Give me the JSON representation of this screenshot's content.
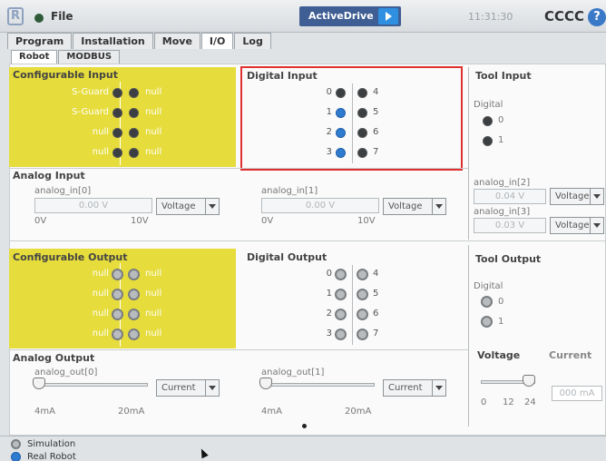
{
  "topbar": {
    "logo": "R",
    "file_label": "File",
    "active_drive_label": "ActiveDrive",
    "clock": "11:31:30",
    "robot_name": "CCCC",
    "help_label": "?"
  },
  "tabs": [
    "Program",
    "Installation",
    "Move",
    "I/O",
    "Log"
  ],
  "subtabs": [
    "Robot",
    "MODBUS"
  ],
  "configurable_input": {
    "title": "Configurable Input",
    "rows": [
      {
        "left": "S-Guard",
        "right": "null"
      },
      {
        "left": "S-Guard",
        "right": "null"
      },
      {
        "left": "null",
        "right": "null"
      },
      {
        "left": "null",
        "right": "null"
      }
    ]
  },
  "digital_input": {
    "title": "Digital Input",
    "rows": [
      {
        "left": "0",
        "right": "4"
      },
      {
        "left": "1",
        "right": "5"
      },
      {
        "left": "2",
        "right": "6"
      },
      {
        "left": "3",
        "right": "7"
      }
    ]
  },
  "tool_input": {
    "title": "Tool Input",
    "digital_label": "Digital",
    "items": [
      "0",
      "1"
    ],
    "analog2_label": "analog_in[2]",
    "analog2_value": "0.04 V",
    "analog2_mode": "Voltage",
    "analog3_label": "analog_in[3]",
    "analog3_value": "0.03 V",
    "analog3_mode": "Voltage"
  },
  "analog_input": {
    "title": "Analog Input",
    "in0_label": "analog_in[0]",
    "in0_value": "0.00 V",
    "in0_mode": "Voltage",
    "in0_min": "0V",
    "in0_max": "10V",
    "in1_label": "analog_in[1]",
    "in1_value": "0.00 V",
    "in1_mode": "Voltage",
    "in1_min": "0V",
    "in1_max": "10V"
  },
  "configurable_output": {
    "title": "Configurable Output",
    "rows": [
      {
        "left": "null",
        "right": "null"
      },
      {
        "left": "null",
        "right": "null"
      },
      {
        "left": "null",
        "right": "null"
      },
      {
        "left": "null",
        "right": "null"
      }
    ]
  },
  "digital_output": {
    "title": "Digital Output",
    "rows": [
      {
        "left": "0",
        "right": "4"
      },
      {
        "left": "1",
        "right": "5"
      },
      {
        "left": "2",
        "right": "6"
      },
      {
        "left": "3",
        "right": "7"
      }
    ]
  },
  "tool_output": {
    "title": "Tool Output",
    "digital_label": "Digital",
    "items": [
      "0",
      "1"
    ],
    "voltage_label": "Voltage",
    "current_label": "Current",
    "voltage_ticks": [
      "0",
      "12",
      "24"
    ],
    "current_value": "000 mA",
    "voltage_fraction": 1.0
  },
  "analog_output": {
    "title": "Analog Output",
    "out0_label": "analog_out[0]",
    "out0_mode": "Current",
    "out0_min": "4mA",
    "out0_max": "20mA",
    "out0_fraction": 0.0,
    "out1_label": "analog_out[1]",
    "out1_mode": "Current",
    "out1_min": "4mA",
    "out1_max": "20mA",
    "out1_fraction": 0.0
  },
  "footer": {
    "simulation_label": "Simulation",
    "real_robot_label": "Real Robot"
  },
  "colors": {
    "yellow_panel": "#e6dc3c",
    "active_drive": "#3f5e93",
    "play_button": "#2f8fe0",
    "input_on": "#2f7bd0",
    "highlight_box": "#e03030"
  }
}
